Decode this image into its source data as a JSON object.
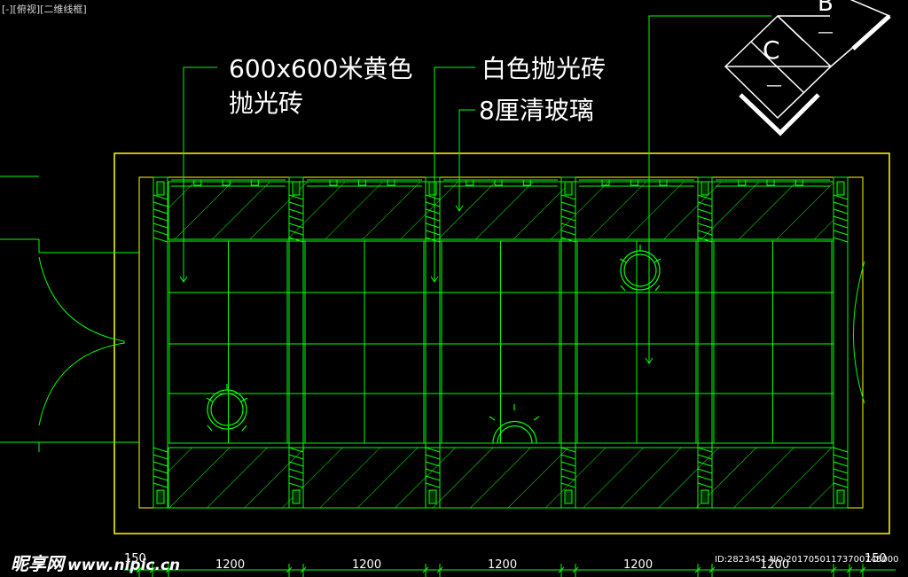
{
  "viewport_label": "[-][俯视][二维线框]",
  "labels": {
    "tile_600": "600x600米黄色",
    "tile_600_line2": "抛光砖",
    "white_tile": "白色抛光砖",
    "glass": "8厘清玻璃"
  },
  "section_marks": {
    "b_letter": "B",
    "b_dash": "—",
    "c_letter": "C",
    "c_dash": "—"
  },
  "dimensions": {
    "left": "150",
    "bays": [
      "1200",
      "1200",
      "1200",
      "1200",
      "1200"
    ],
    "right": "150"
  },
  "watermark": {
    "brand": "昵享网",
    "url": "www.nipic.cn"
  },
  "stamp": "ID:2823451 NO:20170501173700745000",
  "colors": {
    "line": "#00ff00",
    "outline": "#ffff00",
    "text": "#ffffff",
    "background": "#000000"
  }
}
